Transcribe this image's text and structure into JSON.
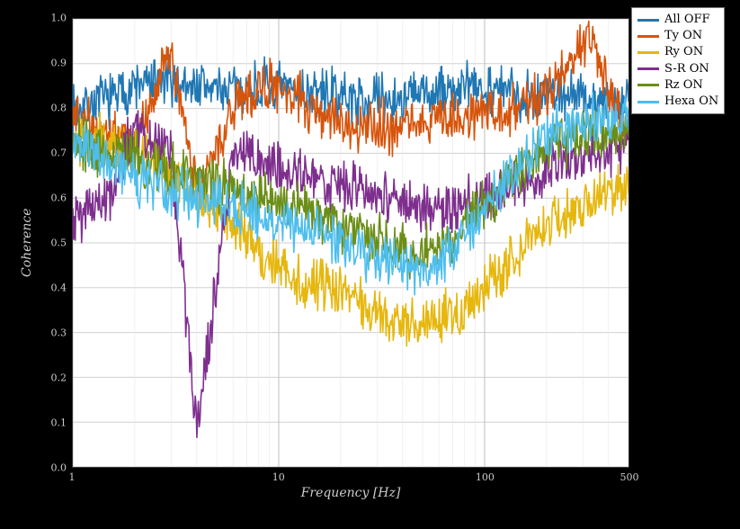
{
  "chart_data": {
    "type": "line",
    "title": "",
    "xlabel": "Frequency [Hz]",
    "ylabel": "Coherence",
    "xscale": "log",
    "yscale": "linear",
    "xlim": [
      1,
      500
    ],
    "ylim": [
      0,
      1
    ],
    "xticks": [
      1,
      10,
      100,
      500
    ],
    "yticks": [
      0.0,
      0.1,
      0.2,
      0.3,
      0.4,
      0.5,
      0.6,
      0.7,
      0.8,
      0.9,
      1.0
    ],
    "grid": true,
    "legend_position": "outside-right-top",
    "series": [
      {
        "name": "All OFF",
        "color": "#1f77b4",
        "x": [
          1,
          1.5,
          2,
          3,
          4,
          6,
          8,
          12,
          18,
          25,
          35,
          50,
          70,
          100,
          150,
          220,
          320,
          500
        ],
        "y": [
          0.8,
          0.82,
          0.85,
          0.86,
          0.85,
          0.84,
          0.85,
          0.84,
          0.83,
          0.82,
          0.82,
          0.83,
          0.84,
          0.85,
          0.83,
          0.84,
          0.82,
          0.82
        ]
      },
      {
        "name": "Ty ON",
        "color": "#d7540b",
        "x": [
          1,
          1.5,
          2,
          3,
          4,
          6,
          8,
          12,
          18,
          25,
          35,
          50,
          70,
          100,
          150,
          220,
          320,
          500
        ],
        "y": [
          0.78,
          0.74,
          0.72,
          0.94,
          0.6,
          0.8,
          0.86,
          0.82,
          0.78,
          0.76,
          0.76,
          0.77,
          0.78,
          0.79,
          0.8,
          0.85,
          0.96,
          0.72
        ]
      },
      {
        "name": "Ry ON",
        "color": "#e6b70e",
        "x": [
          1,
          1.5,
          2,
          3,
          4,
          6,
          8,
          12,
          18,
          25,
          35,
          50,
          70,
          100,
          150,
          220,
          320,
          500
        ],
        "y": [
          0.73,
          0.72,
          0.71,
          0.66,
          0.6,
          0.55,
          0.48,
          0.42,
          0.4,
          0.36,
          0.33,
          0.32,
          0.34,
          0.4,
          0.48,
          0.55,
          0.6,
          0.62
        ]
      },
      {
        "name": "S-R ON",
        "color": "#7e2f8e",
        "x": [
          1,
          1.5,
          2,
          3,
          4,
          6,
          8,
          12,
          18,
          25,
          35,
          50,
          70,
          100,
          150,
          220,
          320,
          500
        ],
        "y": [
          0.55,
          0.6,
          0.76,
          0.7,
          0.08,
          0.7,
          0.68,
          0.66,
          0.63,
          0.62,
          0.6,
          0.58,
          0.58,
          0.6,
          0.63,
          0.68,
          0.7,
          0.72
        ]
      },
      {
        "name": "Rz ON",
        "color": "#6b8e16",
        "x": [
          1,
          1.5,
          2,
          3,
          4,
          6,
          8,
          12,
          18,
          25,
          35,
          50,
          70,
          100,
          150,
          220,
          320,
          500
        ],
        "y": [
          0.73,
          0.7,
          0.69,
          0.66,
          0.64,
          0.62,
          0.6,
          0.58,
          0.55,
          0.52,
          0.5,
          0.48,
          0.5,
          0.58,
          0.66,
          0.72,
          0.74,
          0.75
        ]
      },
      {
        "name": "Hexa ON",
        "color": "#4dbeee",
        "x": [
          1,
          1.5,
          2,
          3,
          4,
          6,
          8,
          12,
          18,
          25,
          35,
          50,
          70,
          100,
          150,
          220,
          320,
          500
        ],
        "y": [
          0.72,
          0.68,
          0.64,
          0.62,
          0.6,
          0.58,
          0.56,
          0.54,
          0.52,
          0.48,
          0.45,
          0.43,
          0.48,
          0.58,
          0.68,
          0.75,
          0.78,
          0.78
        ]
      }
    ]
  },
  "legend": {
    "items": [
      {
        "label": "All OFF",
        "color": "#1f77b4"
      },
      {
        "label": "Ty ON",
        "color": "#d7540b"
      },
      {
        "label": "Ry ON",
        "color": "#e6b70e"
      },
      {
        "label": "S-R ON",
        "color": "#7e2f8e"
      },
      {
        "label": "Rz ON",
        "color": "#6b8e16"
      },
      {
        "label": "Hexa ON",
        "color": "#4dbeee"
      }
    ]
  }
}
